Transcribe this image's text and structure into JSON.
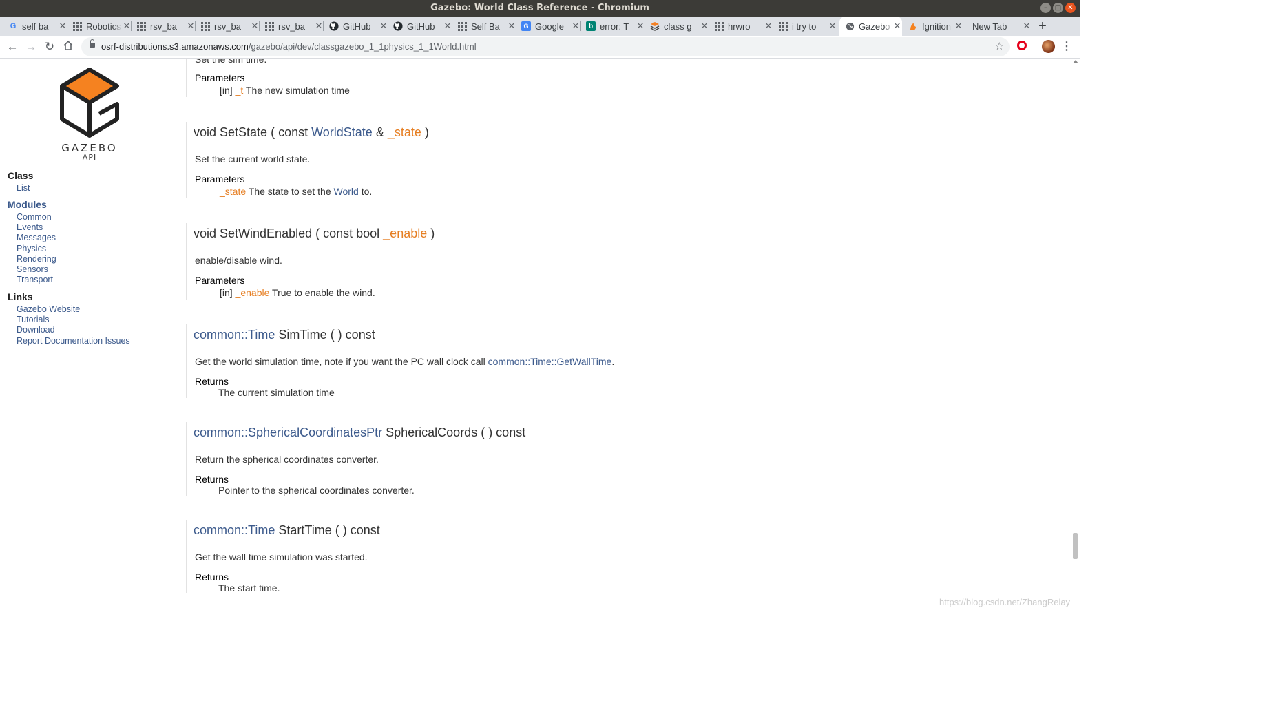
{
  "window": {
    "title": "Gazebo: World Class Reference - Chromium"
  },
  "tabs": [
    {
      "title": "self ba",
      "icon": "google-icon"
    },
    {
      "title": "Robotics",
      "icon": "apps-grid-icon"
    },
    {
      "title": "rsv_ba",
      "icon": "apps-grid-icon"
    },
    {
      "title": "rsv_ba",
      "icon": "apps-grid-icon"
    },
    {
      "title": "rsv_ba",
      "icon": "apps-grid-icon"
    },
    {
      "title": "GitHub",
      "icon": "github-icon"
    },
    {
      "title": "GitHub",
      "icon": "github-icon"
    },
    {
      "title": "Self Ba",
      "icon": "apps-grid-icon"
    },
    {
      "title": "Google",
      "icon": "google-translate-icon"
    },
    {
      "title": "error: T",
      "icon": "bing-icon"
    },
    {
      "title": "class g",
      "icon": "stack-icon"
    },
    {
      "title": "hrwro",
      "icon": "apps-grid-icon"
    },
    {
      "title": "i try to",
      "icon": "apps-grid-icon"
    },
    {
      "title": "Gazebo",
      "icon": "globe-icon",
      "active": true
    },
    {
      "title": "Ignition",
      "icon": "ignition-icon"
    },
    {
      "title": "New Tab",
      "icon": ""
    }
  ],
  "toolbar": {
    "url_host": "osrf-distributions.s3.amazonaws.com",
    "url_path": "/gazebo/api/dev/classgazebo_1_1physics_1_1World.html"
  },
  "sidebar": {
    "logo_text": "GAZEBO",
    "logo_sub": "API",
    "class_heading": "Class",
    "class_links": [
      "List"
    ],
    "modules_heading": "Modules",
    "module_links": [
      "Common",
      "Events",
      "Messages",
      "Physics",
      "Rendering",
      "Sensors",
      "Transport"
    ],
    "links_heading": "Links",
    "link_items": [
      "Gazebo Website",
      "Tutorials",
      "Download",
      "Report Documentation Issues"
    ]
  },
  "content": {
    "top_partial": {
      "desc": "Set the sim time.",
      "params_heading": "Parameters",
      "param_dir": "[in]",
      "param_name": "_t",
      "param_desc": "The new simulation time"
    },
    "setstate": {
      "sig_pre": "void SetState ( const ",
      "sig_type": "WorldState",
      "sig_amp": " & ",
      "sig_param": "_state",
      "sig_post": " )",
      "desc": "Set the current world state.",
      "params_heading": "Parameters",
      "param_name": "_state",
      "param_desc_pre": " The state to set the ",
      "param_link": "World",
      "param_desc_post": " to."
    },
    "setwind": {
      "sig_pre": "void SetWindEnabled ( const bool ",
      "sig_param": "_enable",
      "sig_post": " )",
      "desc": "enable/disable wind.",
      "params_heading": "Parameters",
      "param_dir": "[in]",
      "param_name": "_enable",
      "param_desc": " True to enable the wind."
    },
    "simtime": {
      "sig_type": "common::Time",
      "sig_rest": " SimTime (  ) const",
      "desc_pre": "Get the world simulation time, note if you want the PC wall clock call ",
      "desc_link": "common::Time::GetWallTime",
      "desc_post": ".",
      "returns_heading": "Returns",
      "returns": "The current simulation time"
    },
    "spherical": {
      "sig_type": "common::SphericalCoordinatesPtr",
      "sig_rest": " SphericalCoords (  ) const",
      "desc": "Return the spherical coordinates converter.",
      "returns_heading": "Returns",
      "returns": "Pointer to the spherical coordinates converter."
    },
    "starttime": {
      "sig_type": "common::Time",
      "sig_rest": " StartTime (  ) const",
      "desc": "Get the wall time simulation was started.",
      "returns_heading": "Returns",
      "returns": "The start time."
    }
  },
  "watermark": "https://blog.csdn.net/ZhangRelay"
}
